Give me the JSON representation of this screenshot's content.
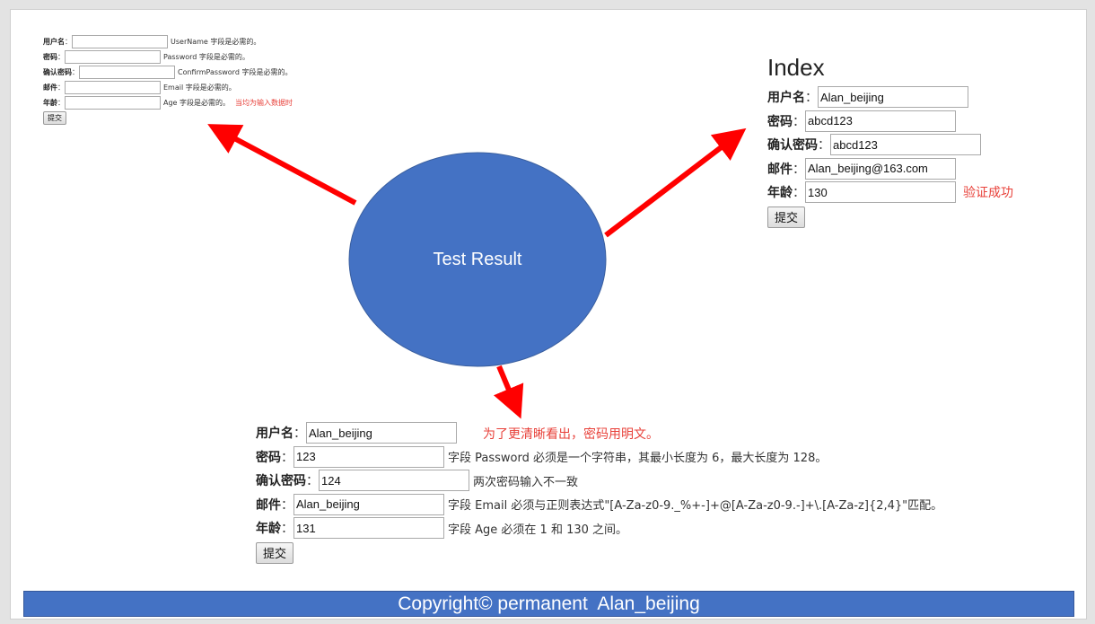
{
  "diagram": {
    "center_label": "Test Result",
    "colors": {
      "ellipse": "#4472c4",
      "arrow": "#ff0000",
      "footer": "#4472c4"
    }
  },
  "form_empty": {
    "fields": [
      {
        "label": "用户名",
        "value": "",
        "message": "UserName 字段是必需的。"
      },
      {
        "label": "密码",
        "value": "",
        "message": "Password 字段是必需的。"
      },
      {
        "label": "确认密码",
        "value": "",
        "message": "ConfirmPassword 字段是必需的。"
      },
      {
        "label": "邮件",
        "value": "",
        "message": "Email 字段是必需的。"
      },
      {
        "label": "年龄",
        "value": "",
        "message": "Age 字段是必需的。"
      }
    ],
    "note": "当均为输入数据时",
    "submit_label": "提交"
  },
  "form_success": {
    "title": "Index",
    "fields": [
      {
        "label": "用户名",
        "value": "Alan_beijing"
      },
      {
        "label": "密码",
        "value": "abcd123"
      },
      {
        "label": "确认密码",
        "value": "abcd123"
      },
      {
        "label": "邮件",
        "value": "Alan_beijing@163.com"
      },
      {
        "label": "年龄",
        "value": "130"
      }
    ],
    "note": "验证成功",
    "submit_label": "提交"
  },
  "form_errors": {
    "fields": [
      {
        "label": "用户名",
        "value": "Alan_beijing",
        "message": ""
      },
      {
        "label": "密码",
        "value": "123",
        "message": "字段 Password 必须是一个字符串，其最小长度为 6，最大长度为 128。"
      },
      {
        "label": "确认密码",
        "value": "124",
        "message": "两次密码输入不一致"
      },
      {
        "label": "邮件",
        "value": "Alan_beijing",
        "message": "字段 Email 必须与正则表达式\"[A-Za-z0-9._%+-]+@[A-Za-z0-9.-]+\\.[A-Za-z]{2,4}\"匹配。"
      },
      {
        "label": "年龄",
        "value": "131",
        "message": "字段 Age 必须在 1 和 130 之间。"
      }
    ],
    "note": "为了更清晰看出，密码用明文。",
    "submit_label": "提交"
  },
  "footer": {
    "text": "Copyright© permanent  Alan_beijing"
  }
}
